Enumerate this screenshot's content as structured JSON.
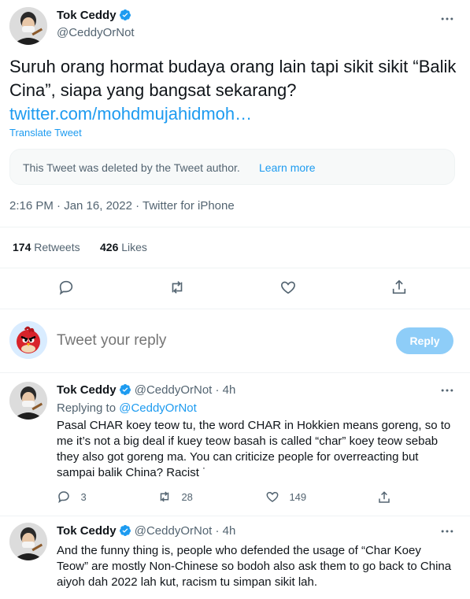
{
  "main_tweet": {
    "author_name": "Tok Ceddy",
    "author_handle": "@CeddyOrNot",
    "text": "Suruh orang hormat budaya orang lain tapi sikit sikit “Balik Cina”, siapa yang bangsat sekarang?",
    "link": "twitter.com/mohdmujahidmoh…",
    "translate": "Translate Tweet",
    "quoted_notice": "This Tweet was deleted by the Tweet author.",
    "learn_more": "Learn more",
    "timestamp": "2:16 PM · Jan 16, 2022 · Twitter for iPhone",
    "retweets_count": "174",
    "retweets_label": "Retweets",
    "likes_count": "426",
    "likes_label": "Likes"
  },
  "reply_box": {
    "placeholder": "Tweet your reply",
    "button": "Reply"
  },
  "replies": [
    {
      "author_name": "Tok Ceddy",
      "author_handle": "@CeddyOrNot",
      "time": "· 4h",
      "replying_to_label": "Replying to",
      "replying_to_handle": "@CeddyOrNot",
      "text": "Pasal CHAR koey teow tu, the word CHAR in Hokkien means goreng, so to me it’s not a big deal if kuey teow basah is called “char” koey teow sebab they also got goreng ma. You can criticize people for overreacting but sampai balik China? Racist ˙",
      "reply_count": "3",
      "retweet_count": "28",
      "like_count": "149"
    },
    {
      "author_name": "Tok Ceddy",
      "author_handle": "@CeddyOrNot",
      "time": "· 4h",
      "text": "And the funny thing is, people who defended the usage of “Char Koey Teow” are mostly Non-Chinese so bodoh also ask them to go back to China aiyoh dah 2022 lah kut, racism tu simpan sikit lah."
    }
  ],
  "colors": {
    "accent": "#1d9bf0",
    "reply_button_disabled": "#8ecdf8",
    "muted_text": "#536471",
    "divider": "#eff3f4"
  },
  "icons": [
    "verified-badge-icon",
    "more-icon",
    "reply-icon",
    "retweet-icon",
    "like-icon",
    "share-icon"
  ]
}
